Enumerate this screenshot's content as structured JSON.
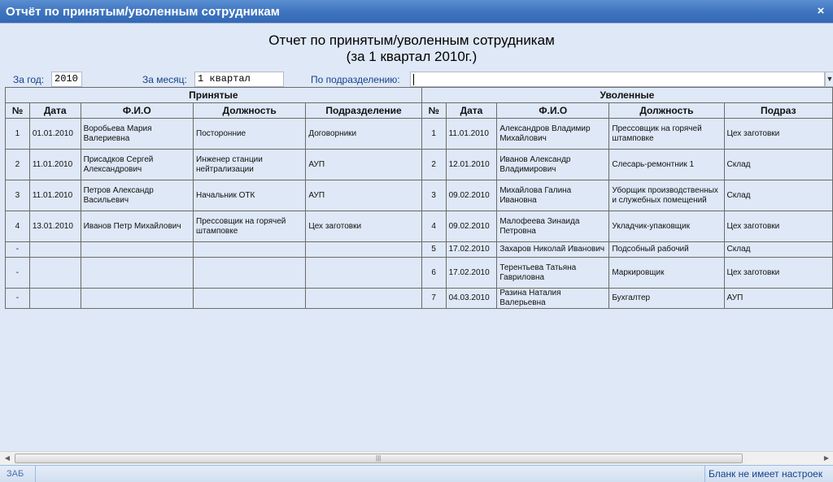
{
  "window": {
    "title": "Отчёт по принятым/уволенным сотрудникам",
    "close_symbol": "×"
  },
  "report": {
    "title_line1": "Отчет по принятым/уволенным сотрудникам",
    "title_line2": "(за 1 квартал 2010г.)"
  },
  "filters": {
    "year_label": "За год:",
    "year_value": "2010",
    "month_label": "За месяц:",
    "month_value": "1 квартал",
    "dept_label": "По подразделению:",
    "dept_value": ""
  },
  "table": {
    "hired_header": "Принятые",
    "fired_header": "Уволенные",
    "columns": [
      "№",
      "Дата",
      "Ф.И.О",
      "Должность",
      "Подразделение"
    ],
    "fired_columns": [
      "№",
      "Дата",
      "Ф.И.О",
      "Должность",
      "Подраз"
    ],
    "rows": [
      {
        "hired": {
          "num": "1",
          "date": "01.01.2010",
          "name": "Воробьева Мария Валериевна",
          "position": "Посторонние",
          "dept": "Договорники"
        },
        "fired": {
          "num": "1",
          "date": "11.01.2010",
          "name": "Александров Владимир Михайлович",
          "position": "Прессовщик на горячей штамповке",
          "dept": "Цех заготовки"
        }
      },
      {
        "hired": {
          "num": "2",
          "date": "11.01.2010",
          "name": "Присадков Сергей Александрович",
          "position": "Инженер станции нейтрализации",
          "dept": "АУП"
        },
        "fired": {
          "num": "2",
          "date": "12.01.2010",
          "name": "Иванов Александр Владимирович",
          "position": "Слесарь-ремонтник 1",
          "dept": "Склад"
        }
      },
      {
        "hired": {
          "num": "3",
          "date": "11.01.2010",
          "name": "Петров Александр Васильевич",
          "position": "Начальник ОТК",
          "dept": "АУП"
        },
        "fired": {
          "num": "3",
          "date": "09.02.2010",
          "name": "Михайлова Галина Ивановна",
          "position": "Уборщик производственных и служебных помещений",
          "dept": "Склад"
        }
      },
      {
        "hired": {
          "num": "4",
          "date": "13.01.2010",
          "name": "Иванов Петр Михайлович",
          "position": "Прессовщик на горячей штамповке",
          "dept": "Цех заготовки"
        },
        "fired": {
          "num": "4",
          "date": "09.02.2010",
          "name": "Малофеева Зинаида Петровна",
          "position": "Укладчик-упаковщик",
          "dept": "Цех заготовки"
        }
      },
      {
        "hired": {
          "num": "-",
          "date": "",
          "name": "",
          "position": "",
          "dept": ""
        },
        "fired": {
          "num": "5",
          "date": "17.02.2010",
          "name": "Захаров Николай Иванович",
          "position": "Подсобный рабочий",
          "dept": "Склад"
        }
      },
      {
        "hired": {
          "num": "-",
          "date": "",
          "name": "",
          "position": "",
          "dept": ""
        },
        "fired": {
          "num": "6",
          "date": "17.02.2010",
          "name": "Терентьева Татьяна Гавриловна",
          "position": "Маркировщик",
          "dept": "Цех заготовки"
        }
      },
      {
        "hired": {
          "num": "-",
          "date": "",
          "name": "",
          "position": "",
          "dept": ""
        },
        "fired": {
          "num": "7",
          "date": "04.03.2010",
          "name": "Разина Наталия Валерьевна",
          "position": "Бухгалтер",
          "dept": "АУП"
        }
      }
    ]
  },
  "scrollbar": {
    "left_arrow": "◀",
    "right_arrow": "▶",
    "grip": "|||"
  },
  "statusbar": {
    "left_text": "ЗАБ",
    "right_text": "Бланк не имеет настроек"
  }
}
